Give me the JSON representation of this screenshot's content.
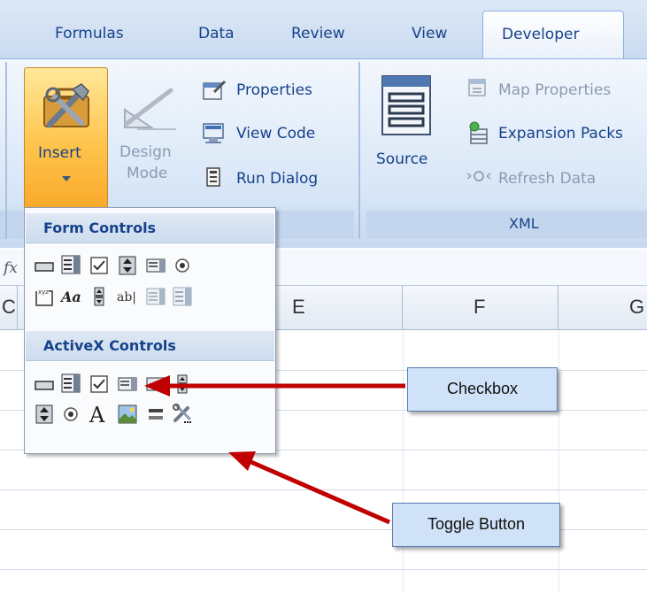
{
  "tabs": [
    {
      "label": "Formulas"
    },
    {
      "label": "Data"
    },
    {
      "label": "Review"
    },
    {
      "label": "View"
    }
  ],
  "active_tab": {
    "label": "Developer"
  },
  "controls_group": {
    "insert_label": "Insert",
    "design_mode_line1": "Design",
    "design_mode_line2": "Mode",
    "properties": "Properties",
    "view_code": "View Code",
    "run_dialog": "Run Dialog"
  },
  "xml_group": {
    "source": "Source",
    "map_properties": "Map Properties",
    "expansion_packs": "Expansion Packs",
    "refresh_data": "Refresh Data",
    "group_label": "XML"
  },
  "formula_bar": {
    "fx": "fx"
  },
  "columns": [
    {
      "letter": "C"
    },
    {
      "letter": "E"
    },
    {
      "letter": "F"
    },
    {
      "letter": "G"
    }
  ],
  "insert_menu": {
    "form_controls_header": "Form Controls",
    "activex_controls_header": "ActiveX Controls",
    "form_controls": [
      {
        "icon": "button-icon"
      },
      {
        "icon": "combo-box-icon"
      },
      {
        "icon": "checkbox-icon"
      },
      {
        "icon": "spin-button-icon"
      },
      {
        "icon": "list-box-icon"
      },
      {
        "icon": "option-button-icon"
      },
      {
        "icon": "group-box-icon"
      },
      {
        "icon": "label-icon"
      },
      {
        "icon": "scroll-bar-icon"
      },
      {
        "icon": "text-field-icon"
      },
      {
        "icon": "combo-list-edit-icon"
      },
      {
        "icon": "combo-drop-down-edit-icon"
      }
    ],
    "activex_controls": [
      {
        "icon": "command-button-icon"
      },
      {
        "icon": "combo-box-icon"
      },
      {
        "icon": "checkbox-icon"
      },
      {
        "icon": "list-box-icon"
      },
      {
        "icon": "text-box-icon"
      },
      {
        "icon": "scroll-bar-icon"
      },
      {
        "icon": "spin-button-icon"
      },
      {
        "icon": "option-button-icon"
      },
      {
        "icon": "label-icon"
      },
      {
        "icon": "image-icon"
      },
      {
        "icon": "toggle-button-icon"
      },
      {
        "icon": "more-controls-icon"
      }
    ]
  },
  "annotations": {
    "checkbox": "Checkbox",
    "toggle_button": "Toggle Button"
  },
  "colors": {
    "accent": "#15428b",
    "arrow": "#c00000",
    "callout_fill": "#cfe2f7"
  }
}
